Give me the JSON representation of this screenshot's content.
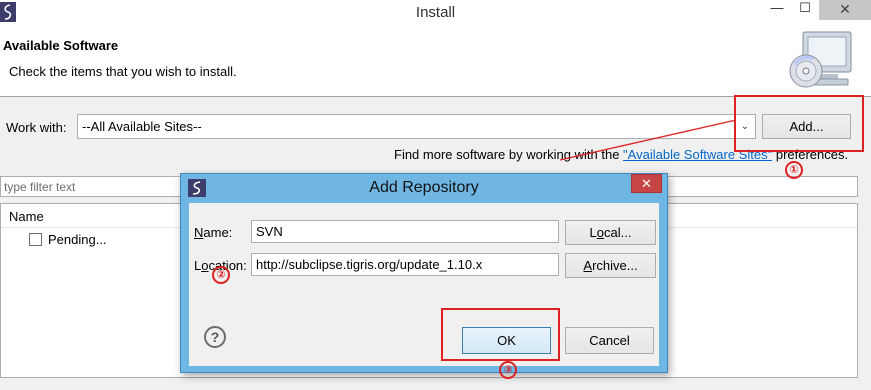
{
  "window": {
    "title": "Install",
    "app_icon": "eclipse-s-icon",
    "min_glyph": "—",
    "max_glyph": "☐",
    "close_glyph": "✕"
  },
  "header": {
    "title": "Available Software",
    "description": "Check the items that you wish to install.",
    "image": "install-computer-cd-icon"
  },
  "work_with": {
    "label": "Work with:",
    "value": "--All Available Sites--",
    "dropdown_icon": "chevron-down-icon",
    "add_label": "Add..."
  },
  "find_more": {
    "prefix": "Find more software by working with the ",
    "link": "\"Available Software Sites\"",
    "suffix": " preferences."
  },
  "filter": {
    "placeholder": "type filter text"
  },
  "tree": {
    "column_header": "Name",
    "rows": [
      {
        "label": "Pending...",
        "checked": false
      }
    ]
  },
  "dialog": {
    "title": "Add Repository",
    "close_glyph": "✕",
    "name_label_mnemonic": "N",
    "name_label_rest": "ame:",
    "name_value": "SVN",
    "location_label_prefix": "L",
    "location_label_mnemonic": "o",
    "location_label_rest": "cation:",
    "location_value": "http://subclipse.tigris.org/update_1.10.x",
    "local_label_prefix": "L",
    "local_label_mnemonic": "o",
    "local_label_rest": "cal...",
    "archive_label_mnemonic": "A",
    "archive_label_rest": "rchive...",
    "ok_label": "OK",
    "cancel_label": "Cancel",
    "help_glyph": "?"
  },
  "annotations": {
    "step1": "①",
    "step2": "②",
    "step3": "③",
    "color": "#dd2222"
  }
}
